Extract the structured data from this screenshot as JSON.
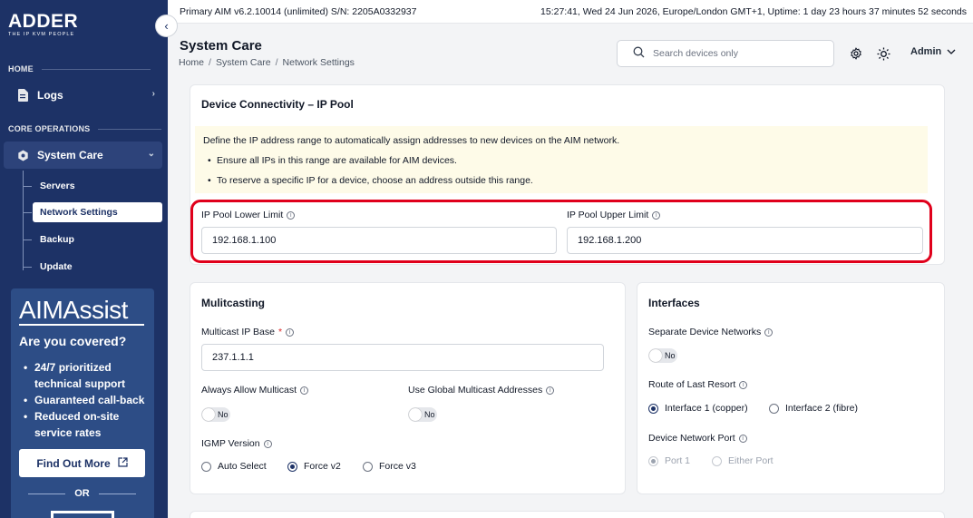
{
  "sidebar": {
    "logo": {
      "word": "ADDER",
      "tagline": "THE IP KVM PEOPLE"
    },
    "sections": [
      {
        "label": "HOME"
      },
      {
        "label": "CORE OPERATIONS"
      }
    ],
    "items": [
      {
        "label": "Logs",
        "icon": "document-icon"
      },
      {
        "label": "System Care",
        "icon": "gear-icon"
      }
    ],
    "sub_items": [
      {
        "label": "Servers"
      },
      {
        "label": "Network Settings"
      },
      {
        "label": "Backup"
      },
      {
        "label": "Update"
      }
    ],
    "promo": {
      "brand": "AIMAssist",
      "heading": "Are you covered?",
      "bullets": [
        "24/7 prioritized technical support",
        "Guaranteed call-back",
        "Reduced on-site service rates"
      ],
      "button": "Find Out More",
      "or": "OR"
    }
  },
  "statusbar": {
    "left": "Primary AIM  v6.2.10014 (unlimited) S/N: 2205A0332937",
    "right": "15:27:41, Wed 24 Jun 2026, Europe/London GMT+1, Uptime: 1 day 23 hours 37 minutes 52 seconds"
  },
  "header": {
    "title": "System Care",
    "breadcrumb": [
      "Home",
      "System Care",
      "Network Settings"
    ],
    "search_placeholder": "Search devices only",
    "user": "Admin"
  },
  "ip_pool": {
    "title": "Device Connectivity – IP Pool",
    "info": "Define the IP address range to automatically assign addresses to new devices on the AIM network.",
    "bullets": [
      "Ensure all IPs in this range are available for AIM devices.",
      "To reserve a specific IP for a device, choose an address outside this range."
    ],
    "lower_label": "IP Pool Lower Limit",
    "lower_value": "192.168.1.100",
    "upper_label": "IP Pool Upper Limit",
    "upper_value": "192.168.1.200"
  },
  "multicasting": {
    "title": "Mulitcasting",
    "base_label": "Multicast IP Base",
    "required_mark": "*",
    "base_value": "237.1.1.1",
    "always_label": "Always Allow Multicast",
    "always_value": "No",
    "global_label": "Use Global Multicast Addresses",
    "global_value": "No",
    "igmp_label": "IGMP Version",
    "igmp_options": [
      "Auto Select",
      "Force v2",
      "Force v3"
    ],
    "igmp_selected": "Force v2"
  },
  "interfaces": {
    "title": "Interfaces",
    "separate_label": "Separate Device Networks",
    "separate_value": "No",
    "route_label": "Route of Last Resort",
    "route_options": [
      "Interface 1 (copper)",
      "Interface 2 (fibre)"
    ],
    "route_selected": "Interface 1 (copper)",
    "port_label": "Device Network Port",
    "port_options": [
      "Port 1",
      "Either Port"
    ],
    "port_selected": "Port 1"
  },
  "colors": {
    "sidebar": "#1d3266",
    "highlight": "#e0001b",
    "info_bg": "#fefbe8"
  }
}
